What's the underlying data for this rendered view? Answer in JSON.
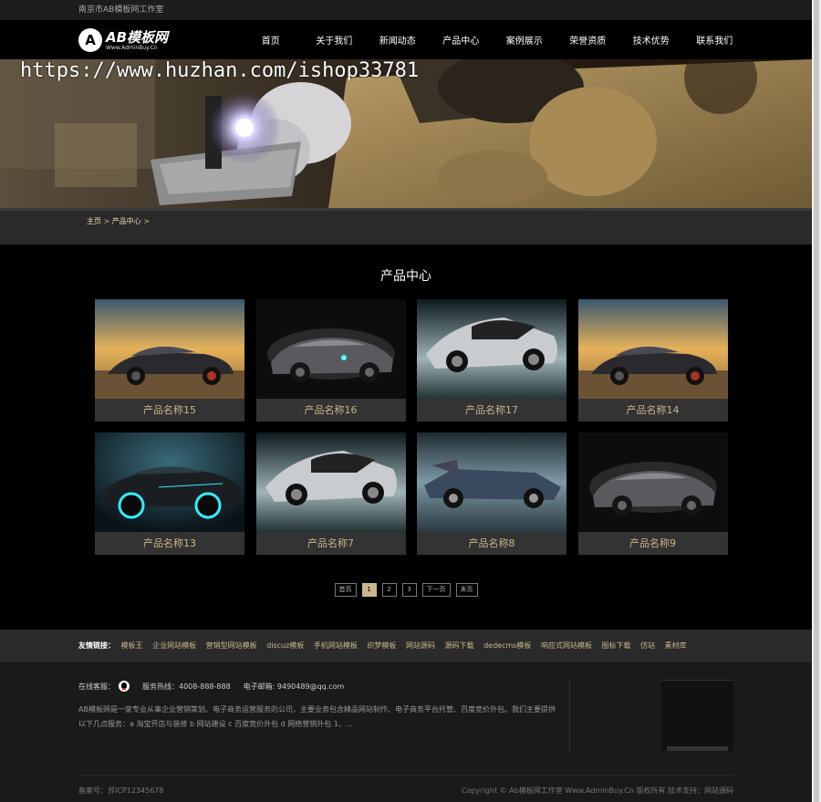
{
  "topbar": {
    "text": "南京市AB模板网工作室"
  },
  "logo": {
    "badge": "A",
    "main": "AB模板网",
    "sub": "Www.AdminBuy.Cn"
  },
  "nav": [
    "首页",
    "关于我们",
    "新闻动态",
    "产品中心",
    "案例展示",
    "荣誉资质",
    "技术优势",
    "联系我们"
  ],
  "banner": {
    "watermark": "https://www.huzhan.com/ishop33781"
  },
  "breadcrumb": {
    "home": "主页",
    "sep": ">",
    "current": "产品中心",
    "sep2": ">"
  },
  "section": {
    "title": "产品中心"
  },
  "products": [
    {
      "name": "产品名称15",
      "image": "sunset-sports-car"
    },
    {
      "name": "产品名称16",
      "image": "dark-roadster"
    },
    {
      "name": "产品名称17",
      "image": "silver-supercar"
    },
    {
      "name": "产品名称14",
      "image": "sunset-sports-car"
    },
    {
      "name": "产品名称13",
      "image": "neon-lamborghini"
    },
    {
      "name": "产品名称7",
      "image": "silver-supercar"
    },
    {
      "name": "产品名称8",
      "image": "concept-racer"
    },
    {
      "name": "产品名称9",
      "image": "dark-roadster"
    }
  ],
  "pagination": {
    "first": "首页",
    "pages": [
      "1",
      "2",
      "3"
    ],
    "active": "1",
    "next": "下一页",
    "last": "末页"
  },
  "links": {
    "label": "友情链接：",
    "items": [
      "模板王",
      "企业网站模板",
      "营销型网站模板",
      "discuz模板",
      "手机网站模板",
      "织梦模板",
      "网站源码",
      "源码下载",
      "dedecms模板",
      "响应式网站模板",
      "图标下载",
      "仿站",
      "素材库"
    ]
  },
  "footer": {
    "online_label": "在线客服：",
    "hotline": "服务热线：4008-888-888",
    "email": "电子邮箱: 9490489@qq.com",
    "about": "AB模板网是一家专业从事企业营销策划、电子商务运营服务的公司，主要业务包含精品网站制作、电子商务平台托管、百度竞价外包。我们主要提供以下几点服务：a 淘宝开店与装修 b 网站建设 c 百度竞价外包 d 网络营销外包 1、...",
    "icp": "备案号：苏ICP12345678",
    "copyright": "Copyright © Ab模板网工作室 Www.AdminBuy.Cn 版权所有 技术支持：网站源码"
  },
  "colors": {
    "accent": "#c8b88a",
    "header_bg": "#000000",
    "footer_bg": "#1a1a1a"
  }
}
